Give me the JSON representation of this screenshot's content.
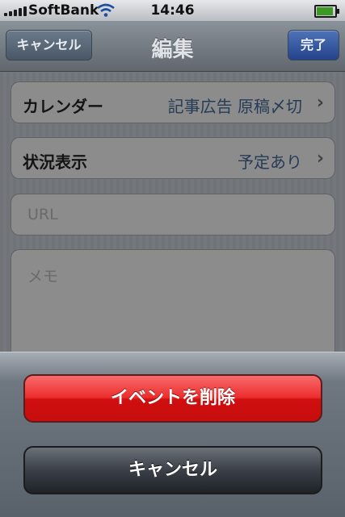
{
  "status_bar": {
    "carrier": "SoftBank",
    "time": "14:46",
    "signal_bars": 5,
    "battery_level": 1.0,
    "icons": [
      "signal-icon",
      "wifi-icon",
      "battery-icon"
    ]
  },
  "nav_bar": {
    "cancel_label": "キャンセル",
    "title": "編集",
    "done_label": "完了"
  },
  "form": {
    "calendar": {
      "label": "カレンダー",
      "value": "記事広告 原稿〆切"
    },
    "availability": {
      "label": "状況表示",
      "value": "予定あり"
    },
    "url_placeholder": "URL",
    "notes_placeholder": "メモ"
  },
  "action_sheet": {
    "delete_label": "イベントを削除",
    "cancel_label": "キャンセル"
  },
  "colors": {
    "delete_red": "#e62020",
    "done_blue": "#2f4f98",
    "nav_bar": "#747c84"
  }
}
